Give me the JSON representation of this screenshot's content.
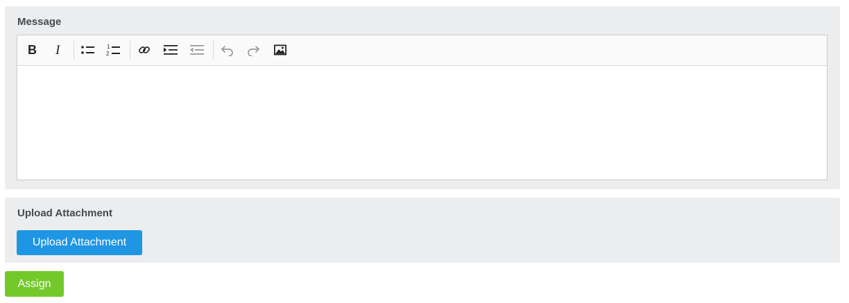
{
  "message": {
    "label": "Message",
    "toolbar": [
      {
        "name": "bold-icon",
        "enabled": true
      },
      {
        "name": "italic-icon",
        "enabled": true
      },
      {
        "name": "bulleted-list-icon",
        "enabled": true
      },
      {
        "name": "numbered-list-icon",
        "enabled": true
      },
      {
        "name": "link-icon",
        "enabled": true
      },
      {
        "name": "indent-icon",
        "enabled": true
      },
      {
        "name": "outdent-icon",
        "enabled": false
      },
      {
        "name": "undo-icon",
        "enabled": false
      },
      {
        "name": "redo-icon",
        "enabled": false
      },
      {
        "name": "image-icon",
        "enabled": true
      }
    ],
    "body_text": ""
  },
  "upload": {
    "label": "Upload Attachment",
    "button_label": "Upload Attachment"
  },
  "assign": {
    "button_label": "Assign"
  },
  "colors": {
    "panel_bg": "#ecedef",
    "upload_button": "#1e96e4",
    "assign_button": "#74c82c",
    "label_text": "#444a50"
  }
}
